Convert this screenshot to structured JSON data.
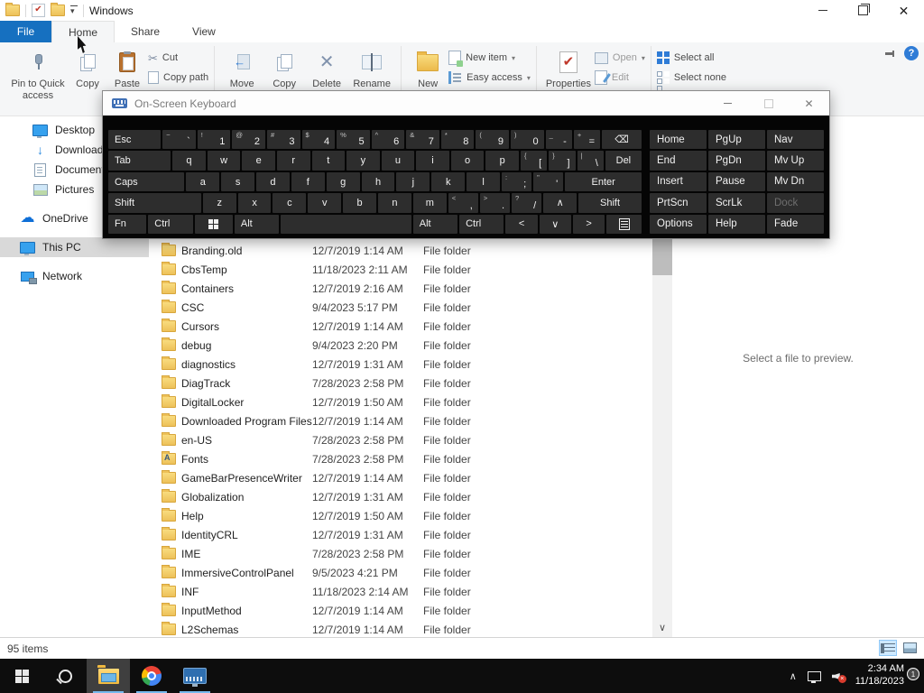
{
  "titlebar": {
    "title": "Windows"
  },
  "tabs": {
    "file": "File",
    "home": "Home",
    "share": "Share",
    "view": "View"
  },
  "ribbon": {
    "pin_quick": "Pin to Quick access",
    "copy": "Copy",
    "paste": "Paste",
    "cut": "Cut",
    "copy_path": "Copy path",
    "move": "Move",
    "copy_to": "Copy",
    "del": "Delete",
    "rename": "Rename",
    "new": "New",
    "new_item": "New item",
    "easy_access": "Easy access",
    "properties": "Properties",
    "open": "Open",
    "edit": "Edit",
    "select_all": "Select all",
    "select_none": "Select none"
  },
  "sidebar": {
    "items": [
      {
        "label": "Desktop",
        "icon": "desktop",
        "indent": true
      },
      {
        "label": "Downloads",
        "icon": "downloads",
        "indent": true
      },
      {
        "label": "Documents",
        "icon": "documents",
        "indent": true
      },
      {
        "label": "Pictures",
        "icon": "pictures",
        "indent": true
      },
      {
        "label": "OneDrive",
        "icon": "onedrive",
        "gap": true
      },
      {
        "label": "This PC",
        "icon": "thispc",
        "gap": true,
        "selected": true
      },
      {
        "label": "Network",
        "icon": "network",
        "gap": true
      }
    ]
  },
  "files": {
    "type_label": "File folder",
    "rows": [
      {
        "name": "Branding.old",
        "date": "12/7/2019 1:14 AM"
      },
      {
        "name": "CbsTemp",
        "date": "11/18/2023 2:11 AM"
      },
      {
        "name": "Containers",
        "date": "12/7/2019 2:16 AM"
      },
      {
        "name": "CSC",
        "date": "9/4/2023 5:17 PM"
      },
      {
        "name": "Cursors",
        "date": "12/7/2019 1:14 AM"
      },
      {
        "name": "debug",
        "date": "9/4/2023 2:20 PM"
      },
      {
        "name": "diagnostics",
        "date": "12/7/2019 1:31 AM"
      },
      {
        "name": "DiagTrack",
        "date": "7/28/2023 2:58 PM"
      },
      {
        "name": "DigitalLocker",
        "date": "12/7/2019 1:50 AM"
      },
      {
        "name": "Downloaded Program Files",
        "date": "12/7/2019 1:14 AM"
      },
      {
        "name": "en-US",
        "date": "7/28/2023 2:58 PM"
      },
      {
        "name": "Fonts",
        "date": "7/28/2023 2:58 PM",
        "icon": "fonts"
      },
      {
        "name": "GameBarPresenceWriter",
        "date": "12/7/2019 1:14 AM"
      },
      {
        "name": "Globalization",
        "date": "12/7/2019 1:31 AM"
      },
      {
        "name": "Help",
        "date": "12/7/2019 1:50 AM"
      },
      {
        "name": "IdentityCRL",
        "date": "12/7/2019 1:31 AM"
      },
      {
        "name": "IME",
        "date": "7/28/2023 2:58 PM"
      },
      {
        "name": "ImmersiveControlPanel",
        "date": "9/5/2023 4:21 PM"
      },
      {
        "name": "INF",
        "date": "11/18/2023 2:14 AM"
      },
      {
        "name": "InputMethod",
        "date": "12/7/2019 1:14 AM"
      },
      {
        "name": "L2Schemas",
        "date": "12/7/2019 1:14 AM"
      }
    ]
  },
  "preview": {
    "empty_text": "Select a file to preview."
  },
  "statusbar": {
    "items_count": "95 items"
  },
  "osk": {
    "title": "On-Screen Keyboard",
    "rows": [
      [
        {
          "k": "Esc",
          "w": 1.4,
          "m": 1
        },
        {
          "k": "`",
          "s": "~"
        },
        {
          "k": "1",
          "s": "!"
        },
        {
          "k": "2",
          "s": "@"
        },
        {
          "k": "3",
          "s": "#"
        },
        {
          "k": "4",
          "s": "$"
        },
        {
          "k": "5",
          "s": "%"
        },
        {
          "k": "6",
          "s": "^"
        },
        {
          "k": "7",
          "s": "&"
        },
        {
          "k": "8",
          "s": "*"
        },
        {
          "k": "9",
          "s": "("
        },
        {
          "k": "0",
          "s": ")"
        },
        {
          "k": "-",
          "s": "_",
          "w": 0.8
        },
        {
          "k": "=",
          "s": "+",
          "w": 0.8
        },
        {
          "k": "⌫",
          "w": 1.2,
          "n": "backspace-key"
        }
      ],
      [
        {
          "k": "Tab",
          "w": 1.7,
          "m": 1
        },
        {
          "k": "q"
        },
        {
          "k": "w"
        },
        {
          "k": "e"
        },
        {
          "k": "r"
        },
        {
          "k": "t"
        },
        {
          "k": "y"
        },
        {
          "k": "u"
        },
        {
          "k": "i"
        },
        {
          "k": "o"
        },
        {
          "k": "p"
        },
        {
          "k": "[",
          "s": "{",
          "w": 0.8
        },
        {
          "k": "]",
          "s": "}",
          "w": 0.8
        },
        {
          "k": "\\",
          "s": "|",
          "w": 0.8
        },
        {
          "k": "Del",
          "w": 1.1
        }
      ],
      [
        {
          "k": "Caps",
          "w": 2.1,
          "m": 1
        },
        {
          "k": "a"
        },
        {
          "k": "s"
        },
        {
          "k": "d"
        },
        {
          "k": "f"
        },
        {
          "k": "g"
        },
        {
          "k": "h"
        },
        {
          "k": "j"
        },
        {
          "k": "k"
        },
        {
          "k": "l"
        },
        {
          "k": ";",
          "s": ":",
          "w": 0.9
        },
        {
          "k": "'",
          "s": "\"",
          "w": 0.9
        },
        {
          "k": "Enter",
          "w": 2.3
        }
      ],
      [
        {
          "k": "Shift",
          "w": 2.6,
          "m": 1
        },
        {
          "k": "z"
        },
        {
          "k": "x"
        },
        {
          "k": "c"
        },
        {
          "k": "v"
        },
        {
          "k": "b"
        },
        {
          "k": "n"
        },
        {
          "k": "m"
        },
        {
          "k": ",",
          "s": "<",
          "w": 0.9
        },
        {
          "k": ".",
          "s": ">",
          "w": 0.9
        },
        {
          "k": "/",
          "s": "?",
          "w": 0.9
        },
        {
          "k": "∧",
          "n": "up-arrow-key"
        },
        {
          "k": "Shift",
          "w": 1.9
        }
      ],
      [
        {
          "k": "Fn",
          "m": 1
        },
        {
          "k": "Ctrl",
          "w": 1.2,
          "m": 1
        },
        {
          "k": "win",
          "w": 1.2,
          "n": "windows-key"
        },
        {
          "k": "Alt",
          "w": 1.2,
          "m": 1
        },
        {
          "k": "space",
          "w": 4.1,
          "n": "space-key"
        },
        {
          "k": "Alt",
          "w": 1.2,
          "m": 1
        },
        {
          "k": "Ctrl",
          "w": 1.2,
          "m": 1
        },
        {
          "k": "<",
          "n": "left-arrow-key"
        },
        {
          "k": "∨",
          "n": "down-arrow-key"
        },
        {
          "k": ">",
          "n": "right-arrow-key"
        },
        {
          "k": "menu",
          "w": 1.1,
          "n": "menu-key"
        }
      ]
    ],
    "nav": [
      [
        "Home",
        "PgUp",
        "Nav"
      ],
      [
        "End",
        "PgDn",
        "Mv Up"
      ],
      [
        "Insert",
        "Pause",
        "Mv Dn"
      ],
      [
        "PrtScn",
        "ScrLk",
        "Dock"
      ],
      [
        "Options",
        "Help",
        "Fade"
      ]
    ],
    "disabled_key": "Dock"
  },
  "taskbar": {
    "time": "2:34 AM",
    "date": "11/18/2023",
    "notification_count": "1"
  }
}
